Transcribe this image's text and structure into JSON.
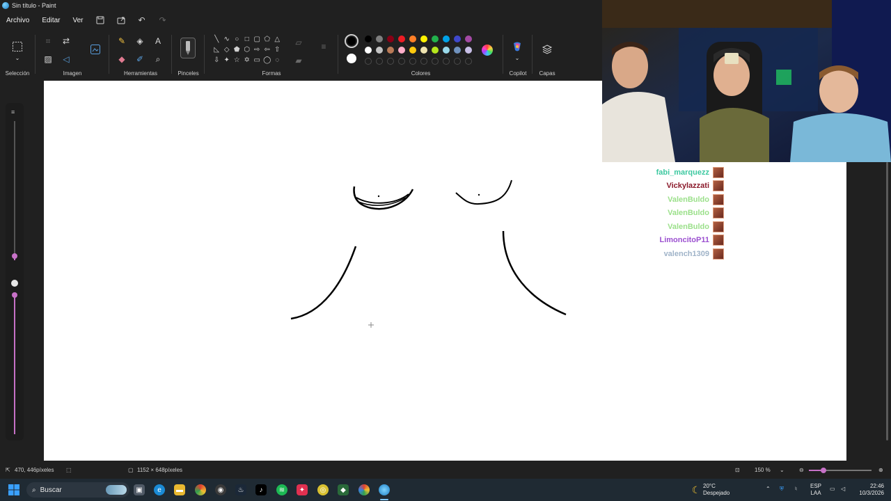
{
  "window": {
    "title": "Sin título - Paint"
  },
  "menu": {
    "file": "Archivo",
    "edit": "Editar",
    "view": "Ver"
  },
  "ribbon": {
    "selection": "Selección",
    "image": "Imagen",
    "tools": "Herramientas",
    "brushes": "Pinceles",
    "shapes": "Formas",
    "colors": "Colores",
    "copilot": "Copilot",
    "layers": "Capas"
  },
  "palette": {
    "row1": [
      "#000000",
      "#7f7f7f",
      "#880015",
      "#ed1c24",
      "#ff7f27",
      "#fff200",
      "#22b14c",
      "#00a2e8",
      "#3f48cc",
      "#a349a4"
    ],
    "row2": [
      "#ffffff",
      "#c3c3c3",
      "#b97a57",
      "#ffaec9",
      "#ffc90e",
      "#efe4b0",
      "#b5e61d",
      "#99d9ea",
      "#7092be",
      "#c8bfe7"
    ],
    "primary": "#000000",
    "secondary": "#ffffff"
  },
  "chat": [
    {
      "name": "fabi_marquezz",
      "color": "#3cc8a0"
    },
    {
      "name": "Vickylazzati",
      "color": "#8b1a2b"
    },
    {
      "name": "ValenBuldo",
      "color": "#9be08a"
    },
    {
      "name": "ValenBuldo",
      "color": "#9be08a"
    },
    {
      "name": "ValenBuldo",
      "color": "#9be08a"
    },
    {
      "name": "LimoncitoP11",
      "color": "#9b4fd0"
    },
    {
      "name": "valench1309",
      "color": "#9fb3c8"
    }
  ],
  "status": {
    "cursor_pos": "470, 446píxeles",
    "canvas_size": "1152 × 648píxeles",
    "zoom": "150 %"
  },
  "taskbar": {
    "search": "Buscar",
    "weather_temp": "20°C",
    "weather_desc": "Despejado",
    "lang_top": "ESP",
    "lang_bottom": "LAA",
    "time": "22:46",
    "date": "10/3/2026"
  }
}
